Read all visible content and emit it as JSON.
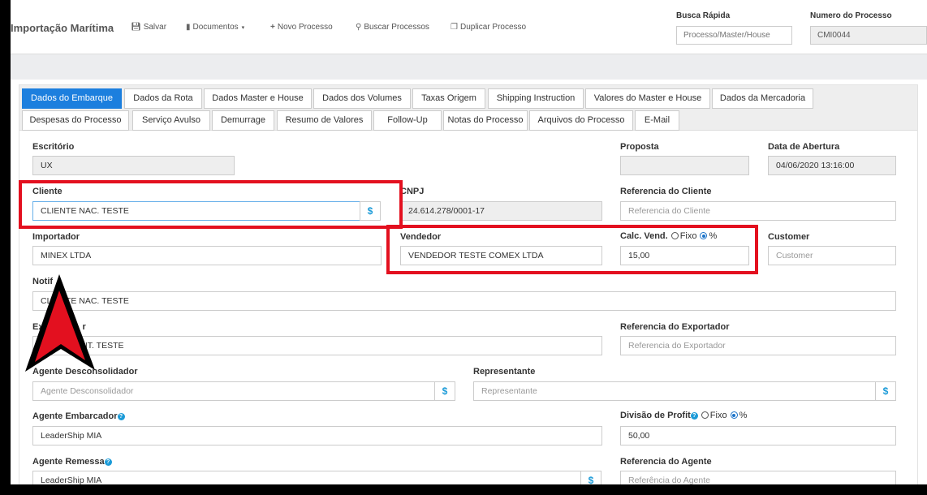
{
  "header": {
    "title": "Importação Marítima",
    "toolbar": {
      "save": "Salvar",
      "documents": "Documentos",
      "new_process": "Novo Processo",
      "search_processes": "Buscar Processos",
      "duplicate_process": "Duplicar Processo"
    },
    "quick_search": {
      "label": "Busca Rápida",
      "placeholder": "Processo/Master/House"
    },
    "process_number": {
      "label": "Numero do Processo",
      "value": "CMI0044"
    }
  },
  "tabs_row1": [
    "Dados do Embarque",
    "Dados da Rota",
    "Dados Master e House",
    "Dados dos Volumes",
    "Taxas Origem",
    "Shipping Instruction",
    "Valores do Master e House",
    "Dados da Mercadoria"
  ],
  "tabs_row2": [
    "Despesas do Processo",
    "Serviço Avulso",
    "Demurrage",
    "Resumo de Valores",
    "Follow-Up",
    "Notas do Processo",
    "Arquivos do Processo",
    "E-Mail"
  ],
  "form": {
    "escritorio": {
      "label": "Escritório",
      "value": "UX"
    },
    "proposta": {
      "label": "Proposta",
      "value": ""
    },
    "data_abertura": {
      "label": "Data de Abertura",
      "value": "04/06/2020 13:16:00"
    },
    "cliente": {
      "label": "Cliente",
      "value": "CLIENTE NAC. TESTE"
    },
    "cnpj": {
      "label": "CNPJ",
      "value": "24.614.278/0001-17"
    },
    "referencia_cliente": {
      "label": "Referencia do Cliente",
      "placeholder": "Referencia do Cliente"
    },
    "importador": {
      "label": "Importador",
      "value": "MINEX LTDA"
    },
    "vendedor": {
      "label": "Vendedor",
      "value": "VENDEDOR TESTE COMEX LTDA"
    },
    "calc_vend": {
      "label": "Calc. Vend.",
      "option_fixo": "Fixo",
      "option_pct": "%",
      "selected": "%",
      "value": "15,00"
    },
    "customer": {
      "label": "Customer",
      "placeholder": "Customer"
    },
    "notify": {
      "label": "Notif",
      "value": "CLIENTE NAC. TESTE"
    },
    "exportador": {
      "label": "Ex",
      "label_end": "r",
      "value_start": "",
      "value": "CLIENTE INT. TESTE"
    },
    "referencia_exportador": {
      "label": "Referencia do Exportador",
      "placeholder": "Referencia do Exportador"
    },
    "agente_desconsolidador": {
      "label": "Agente Desconsolidador",
      "placeholder": "Agente Desconsolidador"
    },
    "representante": {
      "label": "Representante",
      "placeholder": "Representante"
    },
    "agente_embarcador": {
      "label": "Agente Embarcador",
      "value": "LeaderShip MIA"
    },
    "divisao_profit": {
      "label": "Divisão de Profit",
      "option_fixo": "Fixo",
      "option_pct": "%",
      "selected": "%",
      "value": "50,00"
    },
    "agente_remessa": {
      "label": "Agente Remessa",
      "value": "LeaderShip MIA"
    },
    "referencia_agente": {
      "label": "Referencia do Agente",
      "placeholder": "Referência do Agente"
    }
  },
  "colors": {
    "accent": "#1c7fde",
    "highlight": "#e3101f",
    "addon_icon": "#1c9bd8"
  }
}
